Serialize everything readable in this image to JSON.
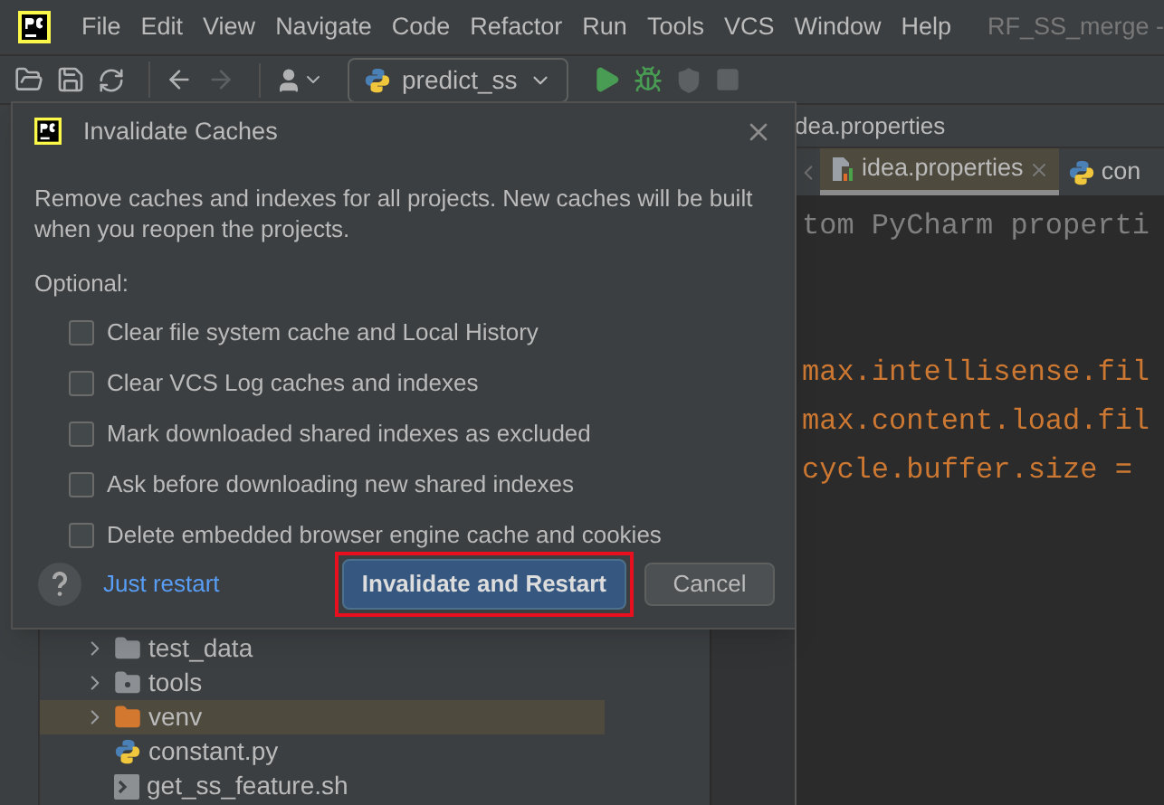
{
  "menu_bar": {
    "items": [
      "File",
      "Edit",
      "View",
      "Navigate",
      "Code",
      "Refactor",
      "Run",
      "Tools",
      "VCS",
      "Window",
      "Help"
    ],
    "project_title": "RF_SS_merge -"
  },
  "toolbar": {
    "buttons": [
      {
        "kind": "open",
        "disabled": false
      },
      {
        "kind": "save",
        "disabled": false
      },
      {
        "kind": "sync",
        "disabled": false
      },
      {
        "kind": "back",
        "disabled": false
      },
      {
        "kind": "forward",
        "disabled": true
      },
      {
        "kind": "user",
        "disabled": false
      },
      {
        "kind": "config",
        "label": "predict_ss",
        "disabled": false
      },
      {
        "kind": "run",
        "disabled": false
      },
      {
        "kind": "debug",
        "disabled": false
      },
      {
        "kind": "coverage",
        "disabled": true
      },
      {
        "kind": "stop",
        "disabled": true
      }
    ]
  },
  "project_tree": [
    {
      "label": "test_data",
      "kind": "folder",
      "expanded": false,
      "selected": false
    },
    {
      "label": "tools",
      "kind": "package",
      "expanded": false,
      "selected": false
    },
    {
      "label": "venv",
      "kind": "excluded",
      "expanded": false,
      "selected": true
    },
    {
      "label": "constant.py",
      "kind": "python",
      "selected": false
    },
    {
      "label": "get_ss_feature.sh",
      "kind": "shell",
      "selected": false
    }
  ],
  "editor": {
    "breadcrumb": "dea.properties",
    "tabs": [
      {
        "label": "idea.properties",
        "kind": "properties",
        "selected": true
      },
      {
        "label": "con",
        "kind": "python",
        "selected": false
      }
    ],
    "code_lines": [
      {
        "text": "tom PyCharm properti",
        "kind": "comment"
      },
      {
        "text": "max.intellisense.fil",
        "kind": "property"
      },
      {
        "text": "max.content.load.fil",
        "kind": "property"
      },
      {
        "text": "cycle.buffer.size =",
        "kind": "property"
      }
    ]
  },
  "dialog": {
    "title": "Invalidate Caches",
    "message": "Remove caches and indexes for all projects. New caches will be built when you reopen the projects.",
    "optional_label": "Optional:",
    "options": [
      {
        "label": "Clear file system cache and Local History",
        "checked": false
      },
      {
        "label": "Clear VCS Log caches and indexes",
        "checked": false
      },
      {
        "label": "Mark downloaded shared indexes as excluded",
        "checked": false
      },
      {
        "label": "Ask before downloading new shared indexes",
        "checked": false
      },
      {
        "label": "Delete embedded browser engine cache and cookies",
        "checked": false
      }
    ],
    "link": "Just restart",
    "primary_button": "Invalidate and Restart",
    "primary_highlighted": true,
    "cancel_button": "Cancel"
  }
}
